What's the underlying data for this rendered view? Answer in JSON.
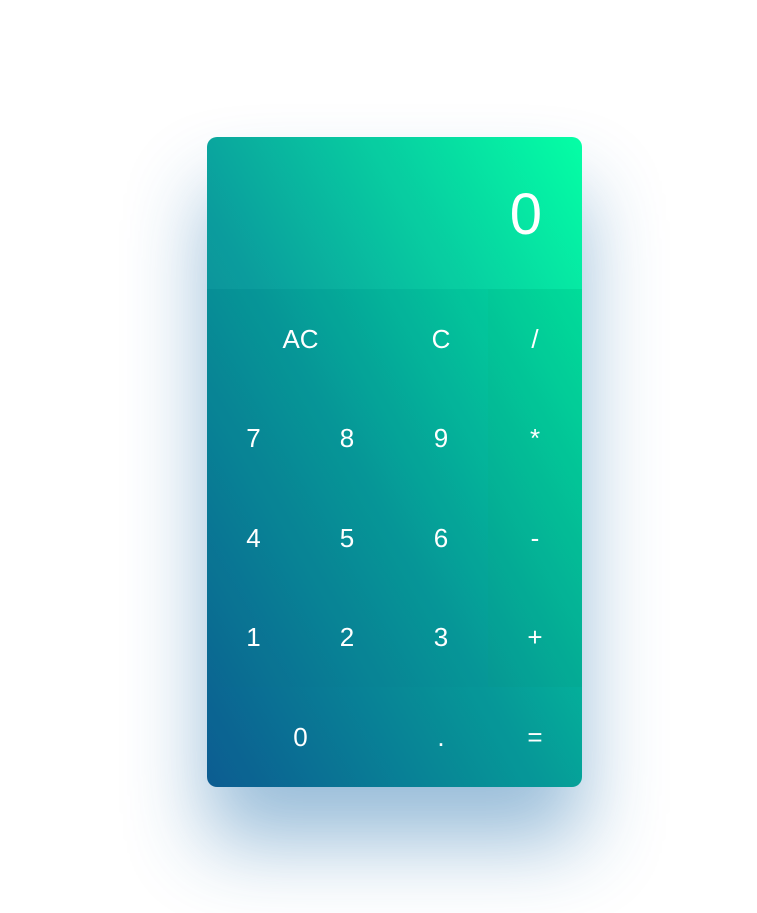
{
  "display": {
    "value": "0"
  },
  "keys": {
    "all_clear": "AC",
    "clear": "C",
    "divide": "/",
    "seven": "7",
    "eight": "8",
    "nine": "9",
    "multiply": "*",
    "four": "4",
    "five": "5",
    "six": "6",
    "subtract": "-",
    "one": "1",
    "two": "2",
    "three": "3",
    "add": "+",
    "zero": "0",
    "decimal": ".",
    "equals": "="
  },
  "colors": {
    "gradient_start": "#0d5e94",
    "gradient_mid": "#079c9c",
    "gradient_end": "#00ffa4",
    "text": "#ffffff",
    "shadow": "#1c6caa"
  }
}
